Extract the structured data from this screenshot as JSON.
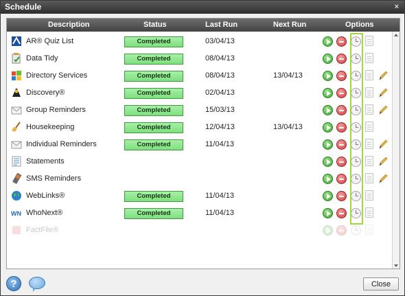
{
  "window": {
    "title": "Schedule",
    "close_glyph": "×"
  },
  "columns": {
    "description": "Description",
    "status": "Status",
    "last_run": "Last Run",
    "next_run": "Next Run",
    "options": "Options"
  },
  "rows": [
    {
      "description": "AR® Quiz List",
      "icon": "ar-quiz-icon",
      "status": "Completed",
      "last_run": "03/04/13",
      "next_run": "",
      "edit": false,
      "enabled": true
    },
    {
      "description": "Data Tidy",
      "icon": "data-tidy-icon",
      "status": "Completed",
      "last_run": "08/04/13",
      "next_run": "",
      "edit": false,
      "enabled": true
    },
    {
      "description": "Directory Services",
      "icon": "windows-logo-icon",
      "status": "Completed",
      "last_run": "08/04/13",
      "next_run": "13/04/13",
      "edit": true,
      "enabled": true
    },
    {
      "description": "Discovery®",
      "icon": "discovery-icon",
      "status": "Completed",
      "last_run": "02/04/13",
      "next_run": "",
      "edit": true,
      "enabled": true
    },
    {
      "description": "Group Reminders",
      "icon": "envelope-icon",
      "status": "Completed",
      "last_run": "15/03/13",
      "next_run": "",
      "edit": true,
      "enabled": true
    },
    {
      "description": "Housekeeping",
      "icon": "broom-icon",
      "status": "Completed",
      "last_run": "12/04/13",
      "next_run": "13/04/13",
      "edit": false,
      "enabled": true
    },
    {
      "description": "Individual Reminders",
      "icon": "envelope-icon",
      "status": "Completed",
      "last_run": "11/04/13",
      "next_run": "",
      "edit": true,
      "enabled": true
    },
    {
      "description": "Statements",
      "icon": "statements-icon",
      "status": "",
      "last_run": "",
      "next_run": "",
      "edit": true,
      "enabled": true
    },
    {
      "description": "SMS Reminders",
      "icon": "mobile-phone-icon",
      "status": "",
      "last_run": "",
      "next_run": "",
      "edit": true,
      "enabled": true
    },
    {
      "description": "WebLinks®",
      "icon": "globe-icon",
      "status": "Completed",
      "last_run": "11/04/13",
      "next_run": "",
      "edit": false,
      "enabled": true
    },
    {
      "description": "WhoNext®",
      "icon": "whonext-icon",
      "status": "Completed",
      "last_run": "11/04/13",
      "next_run": "",
      "edit": false,
      "enabled": true
    },
    {
      "description": "FactFile®",
      "icon": "factfile-icon",
      "status": "",
      "last_run": "",
      "next_run": "",
      "edit": false,
      "enabled": false
    }
  ],
  "option_icons": [
    "run-icon",
    "stop-icon",
    "clock-icon",
    "report-icon",
    "pencil-icon"
  ],
  "colors": {
    "status_fill": "#8ee58e",
    "clock_highlight": "#a2d93b",
    "header": "#555555"
  },
  "footer": {
    "help_glyph": "?",
    "close_label": "Close"
  }
}
